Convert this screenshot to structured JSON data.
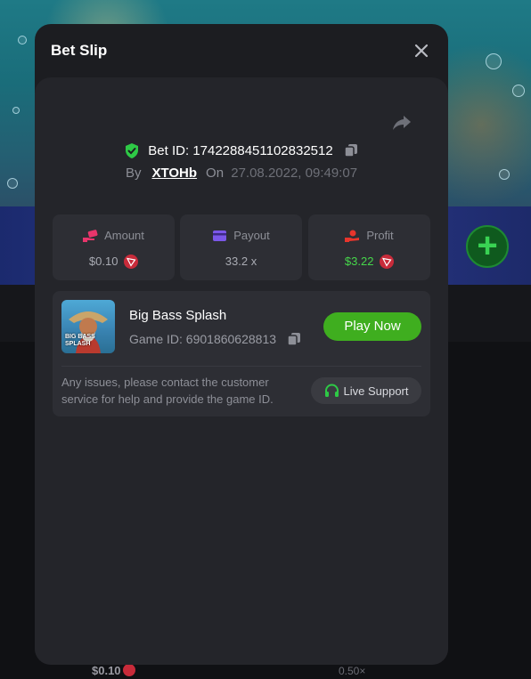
{
  "modal": {
    "title": "Bet Slip",
    "close_icon": "close-icon",
    "share_icon": "share-icon"
  },
  "bet": {
    "id_label": "Bet ID:",
    "id_value": "174228845110283251​2",
    "by_label": "By",
    "user": "XTOHb",
    "on_label": "On",
    "datetime": "27.08.2022, 09:49:07"
  },
  "stats": [
    {
      "label": "Amount",
      "value": "$0.10",
      "icon": "money-hand-icon",
      "color": "#e8356b"
    },
    {
      "label": "Payout",
      "value": "33.2 x",
      "icon": "card-icon",
      "color": "#7b57e8"
    },
    {
      "label": "Profit",
      "value": "$3.22",
      "icon": "hand-coin-icon",
      "color": "#e8352c"
    }
  ],
  "game": {
    "name": "Big Bass Splash",
    "id_label": "Game ID:",
    "id_value": "6901860628813",
    "thumb_text": "BIG BASS SPLASH",
    "play_label": "Play Now"
  },
  "support": {
    "message": "Any issues, please contact the customer service for help and provide the game ID.",
    "button_label": "Live Support"
  },
  "background": {
    "amount": "$0.10",
    "multiplier": "0.50×"
  },
  "colors": {
    "accent_green": "#3fae1f",
    "profit_green": "#46d64a",
    "tron_red": "#c82b3a"
  }
}
